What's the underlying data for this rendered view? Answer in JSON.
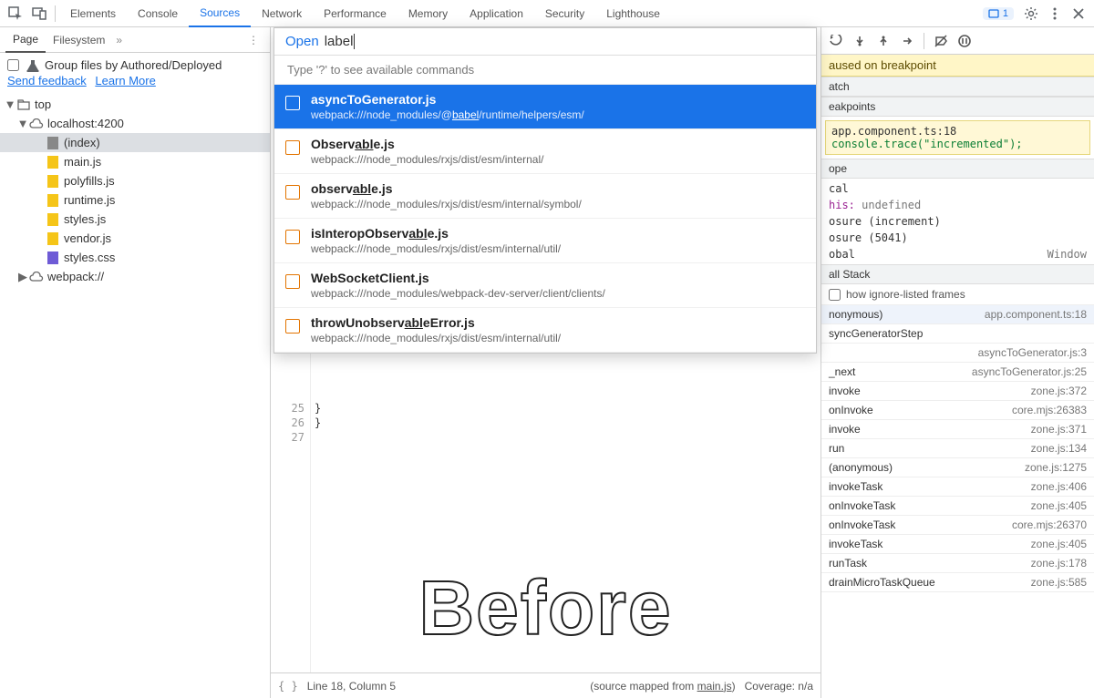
{
  "topTabs": {
    "items": [
      "Elements",
      "Console",
      "Sources",
      "Network",
      "Performance",
      "Memory",
      "Application",
      "Security",
      "Lighthouse"
    ],
    "active": 2,
    "badgeCount": "1"
  },
  "leftTabs": {
    "page": "Page",
    "filesystem": "Filesystem"
  },
  "authored": {
    "label": "Group files by Authored/Deployed",
    "feedback": "Send feedback",
    "learn": "Learn More"
  },
  "tree": {
    "top": "top",
    "host": "localhost:4200",
    "files": [
      "(index)",
      "main.js",
      "polyfills.js",
      "runtime.js",
      "styles.js",
      "vendor.js",
      "styles.css"
    ],
    "webpack": "webpack://"
  },
  "palette": {
    "open": "Open",
    "query": "label",
    "hint": "Type '?' to see available commands",
    "items": [
      {
        "name": "asyncToGenerator.js",
        "path": "webpack:///node_modules/@babel/runtime/helpers/esm/"
      },
      {
        "name": "Observable.js",
        "path": "webpack:///node_modules/rxjs/dist/esm/internal/"
      },
      {
        "name": "observable.js",
        "path": "webpack:///node_modules/rxjs/dist/esm/internal/symbol/"
      },
      {
        "name": "isInteropObservable.js",
        "path": "webpack:///node_modules/rxjs/dist/esm/internal/util/"
      },
      {
        "name": "WebSocketClient.js",
        "path": "webpack:///node_modules/webpack-dev-server/client/clients/"
      },
      {
        "name": "throwUnobservableError.js",
        "path": "webpack:///node_modules/rxjs/dist/esm/internal/util/"
      }
    ]
  },
  "code": {
    "lines": [
      "25",
      "26",
      "27"
    ],
    "text": [
      "  }",
      "}",
      ""
    ]
  },
  "status": {
    "pos": "Line 18, Column 5",
    "mapped_pre": "(source mapped from ",
    "mapped_file": "main.js",
    "mapped_post": ")",
    "coverage": "Coverage: n/a"
  },
  "before": "Before",
  "right": {
    "paused": "aused on breakpoint",
    "watch": "atch",
    "breakpoints": "eakpoints",
    "bp_file": "app.component.ts:18",
    "bp_code": "console.trace(\"incremented\");",
    "scope": "ope",
    "local": "cal",
    "this_k": "his:",
    "this_v": "undefined",
    "cl1": "osure (increment)",
    "cl2": "osure (5041)",
    "global": "obal",
    "window": "Window",
    "callstack": "all Stack",
    "ignore": "how ignore-listed frames",
    "frames": [
      {
        "fn": "nonymous)",
        "loc": "app.component.ts:18"
      },
      {
        "fn": "syncGeneratorStep",
        "loc": ""
      },
      {
        "fn": "",
        "loc": "asyncToGenerator.js:3"
      },
      {
        "fn": "_next",
        "loc": "asyncToGenerator.js:25"
      },
      {
        "fn": "invoke",
        "loc": "zone.js:372"
      },
      {
        "fn": "onInvoke",
        "loc": "core.mjs:26383"
      },
      {
        "fn": "invoke",
        "loc": "zone.js:371"
      },
      {
        "fn": "run",
        "loc": "zone.js:134"
      },
      {
        "fn": "(anonymous)",
        "loc": "zone.js:1275"
      },
      {
        "fn": "invokeTask",
        "loc": "zone.js:406"
      },
      {
        "fn": "onInvokeTask",
        "loc": "zone.js:405"
      },
      {
        "fn": "onInvokeTask",
        "loc": "core.mjs:26370"
      },
      {
        "fn": "invokeTask",
        "loc": "zone.js:405"
      },
      {
        "fn": "runTask",
        "loc": "zone.js:178"
      },
      {
        "fn": "drainMicroTaskQueue",
        "loc": "zone.js:585"
      }
    ]
  }
}
